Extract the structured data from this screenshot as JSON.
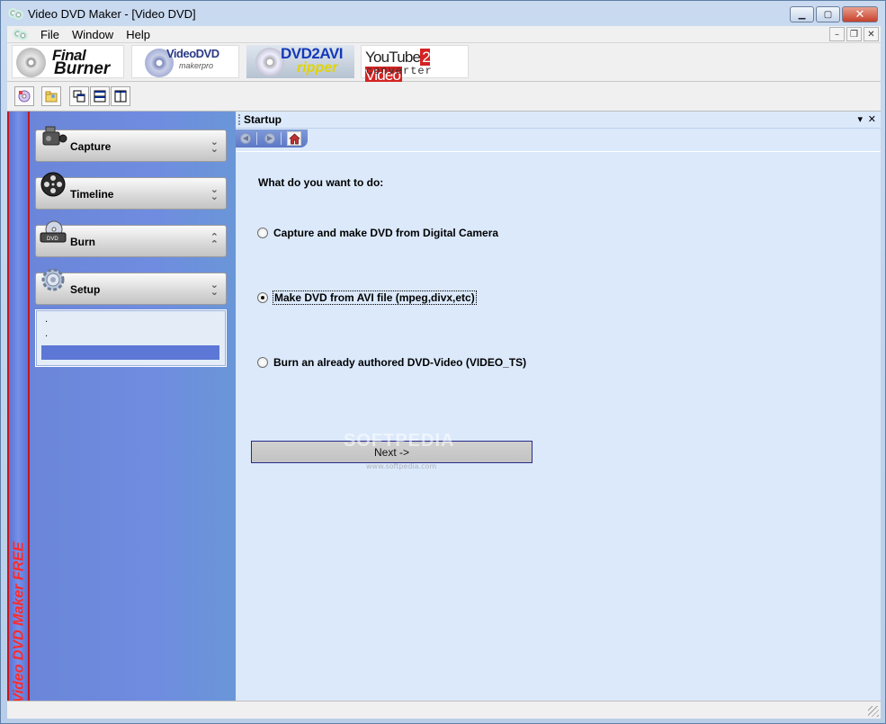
{
  "window": {
    "title": "Video DVD Maker - [Video DVD]"
  },
  "menu": {
    "items": [
      "File",
      "Window",
      "Help"
    ]
  },
  "banners": {
    "final_burner": {
      "line1": "Final",
      "line2": "Burner"
    },
    "videodvd_maker_pro": {
      "line1": "VideoDVD",
      "line2": "makerpro"
    },
    "dvd2avi_ripper": {
      "line1": "DVD2AVI",
      "line2": "ripper"
    },
    "youtube2video": {
      "part1": "YouTube",
      "part2": "2 Video",
      "line2": "converter"
    }
  },
  "sidebar": {
    "brand_vertical": "Video DVD Maker FREE",
    "sections": [
      {
        "label": "Capture",
        "icon": "camcorder-icon",
        "state": "collapsed"
      },
      {
        "label": "Timeline",
        "icon": "film-reel-icon",
        "state": "collapsed"
      },
      {
        "label": "Burn",
        "icon": "dvd-drive-icon",
        "state": "expanded"
      },
      {
        "label": "Setup",
        "icon": "gear-icon",
        "state": "collapsed"
      }
    ],
    "subpanel": {
      "item1": ".",
      "item2": "."
    }
  },
  "main": {
    "panel_title": "Startup",
    "prompt": "What do you want to do:",
    "options": [
      {
        "label": "Capture and make DVD from Digital Camera",
        "checked": false
      },
      {
        "label": "Make DVD from AVI file (mpeg,divx,etc)",
        "checked": true
      },
      {
        "label": "Burn an already authored DVD-Video (VIDEO_TS)",
        "checked": false
      }
    ],
    "next_label": "Next ->",
    "watermark": "SOFTPEDIA",
    "watermark_url": "www.softpedia.com"
  },
  "colors": {
    "sidebar_blue": "#6f8ce0",
    "brand_red": "#ff2a2a",
    "panel_bg": "#dbe9fb"
  }
}
